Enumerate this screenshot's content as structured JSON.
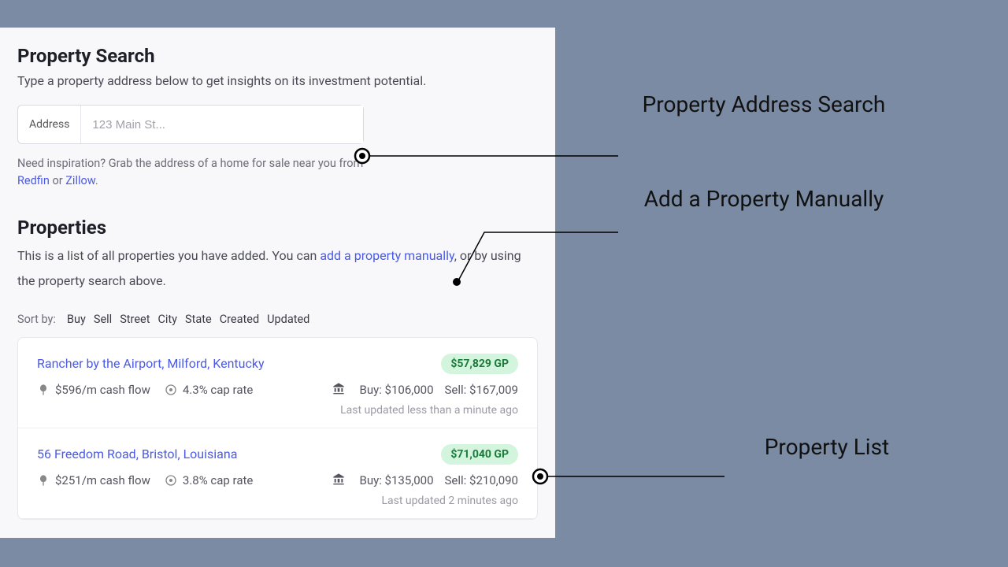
{
  "search": {
    "heading": "Property Search",
    "subtitle": "Type a property address below to get insights on its investment potential.",
    "address_label": "Address",
    "placeholder": "123 Main St...",
    "hint_before": "Need inspiration? Grab the address of a home for sale near you from ",
    "redfin": "Redfin",
    "hint_or": " or ",
    "zillow": "Zillow",
    "hint_after": "."
  },
  "properties": {
    "heading": "Properties",
    "subtitle_before": "This is a list of all properties you have added. You can ",
    "manual_link": "add a property manually",
    "subtitle_after": ", or by using the property search above.",
    "sort_label": "Sort by:",
    "sort_options": [
      "Buy",
      "Sell",
      "Street",
      "City",
      "State",
      "Created",
      "Updated"
    ],
    "cards": [
      {
        "title": "Rancher by the Airport, Milford, Kentucky",
        "gp": "$57,829 GP",
        "cashflow": "$596/m cash flow",
        "caprate": "4.3% cap rate",
        "buy": "Buy: $106,000",
        "sell": "Sell: $167,009",
        "updated": "Last updated less than a minute ago"
      },
      {
        "title": "56 Freedom Road, Bristol, Louisiana",
        "gp": "$71,040 GP",
        "cashflow": "$251/m cash flow",
        "caprate": "3.8% cap rate",
        "buy": "Buy: $135,000",
        "sell": "Sell: $210,090",
        "updated": "Last updated 2 minutes ago"
      }
    ]
  },
  "annotations": {
    "a1": "Property Address Search",
    "a2": "Add a Property Manually",
    "a3": "Property List"
  }
}
